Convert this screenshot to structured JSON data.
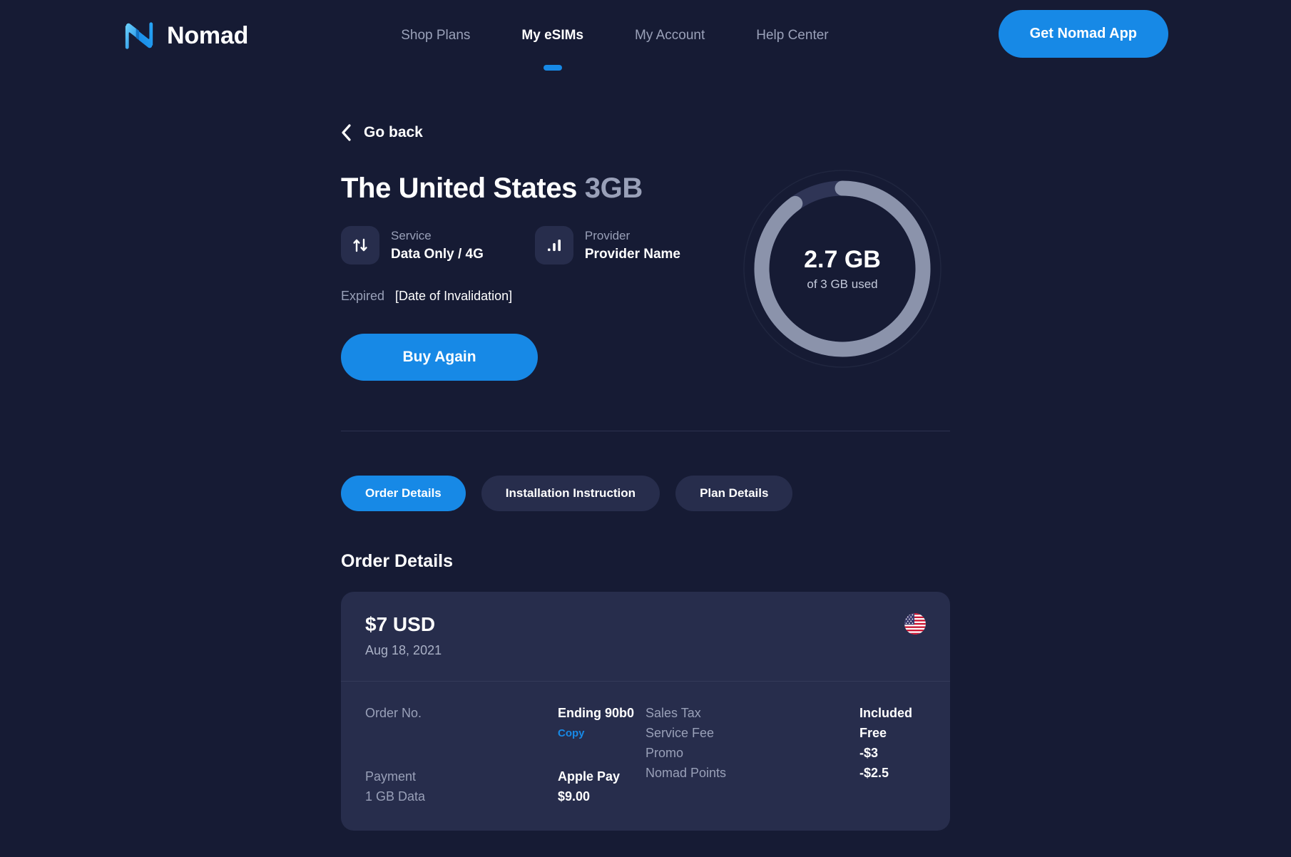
{
  "brand": {
    "name": "Nomad",
    "logo_icon": "nomad-logo-icon"
  },
  "nav": {
    "items": [
      {
        "label": "Shop Plans",
        "active": false
      },
      {
        "label": "My eSIMs",
        "active": true
      },
      {
        "label": "My Account",
        "active": false
      },
      {
        "label": "Help Center",
        "active": false
      }
    ],
    "cta_label": "Get Nomad App"
  },
  "back": {
    "label": "Go back",
    "icon": "chevron-left-icon"
  },
  "plan": {
    "country": "The United States",
    "size": "3GB",
    "service_label": "Service",
    "service_value": "Data Only / 4G",
    "service_icon": "data-transfer-icon",
    "provider_label": "Provider",
    "provider_value": "Provider Name",
    "provider_icon": "signal-bars-icon",
    "expired_label": "Expired",
    "expired_value": "[Date of Invalidation]",
    "buy_again_label": "Buy Again"
  },
  "usage": {
    "value_text": "2.7 GB",
    "sub_text": "of 3 GB used",
    "used_gb": 2.7,
    "total_gb": 3,
    "percent": 90,
    "arc_color": "#8b93ab",
    "track_color": "#2f3556"
  },
  "tabs": [
    {
      "label": "Order Details",
      "active": true
    },
    {
      "label": "Installation Instruction",
      "active": false
    },
    {
      "label": "Plan Details",
      "active": false
    }
  ],
  "order_section": {
    "title": "Order Details",
    "amount": "$7 USD",
    "date": "Aug 18, 2021",
    "flag_icon": "us-flag-icon",
    "left_rows": [
      {
        "key": "Order No.",
        "value": "Ending 90b0",
        "action": "Copy"
      },
      {
        "key": "Payment",
        "value": "Apple Pay"
      },
      {
        "key": "1 GB Data",
        "value": "$9.00"
      }
    ],
    "right_rows": [
      {
        "key": "Sales Tax",
        "value": "Included"
      },
      {
        "key": "Service Fee",
        "value": "Free"
      },
      {
        "key": "Promo",
        "value": "-$3"
      },
      {
        "key": "Nomad Points",
        "value": "-$2.5"
      }
    ]
  },
  "colors": {
    "page_bg": "#161b34",
    "card_bg": "#272d4c",
    "accent": "#1789e6",
    "muted_text": "#99a0b8"
  }
}
